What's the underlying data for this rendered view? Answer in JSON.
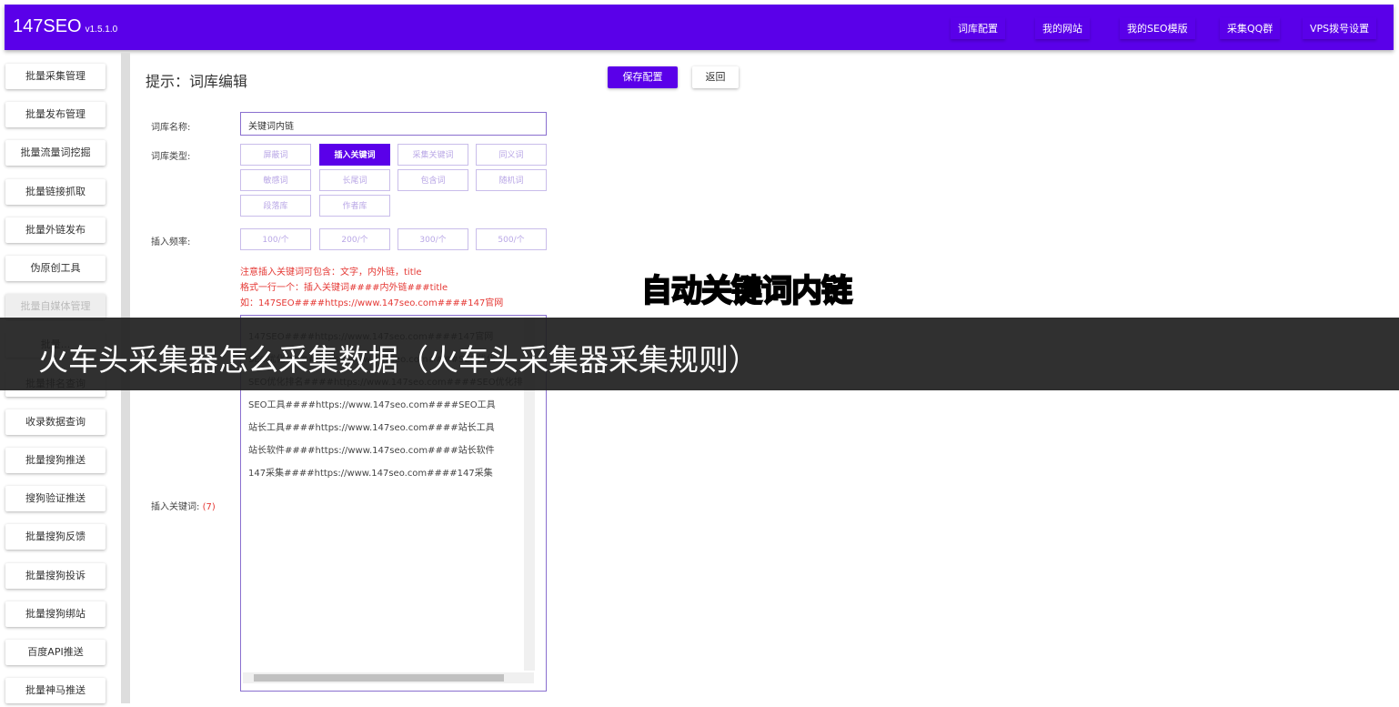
{
  "header": {
    "logo": "147SEO",
    "version": "v1.5.1.0",
    "nav": [
      "词库配置",
      "我的网站",
      "我的SEO模版",
      "采集QQ群",
      "VPS拨号设置"
    ]
  },
  "sidebar": {
    "items": [
      "批量采集管理",
      "批量发布管理",
      "批量流量词挖掘",
      "批量链接抓取",
      "批量外链发布",
      "伪原创工具",
      "批量自媒体管理",
      "批量...",
      "批量排名查询",
      "收录数据查询",
      "批量搜狗推送",
      "搜狗验证推送",
      "批量搜狗反馈",
      "批量搜狗投诉",
      "批量搜狗绑站",
      "百度API推送",
      "批量神马推送"
    ]
  },
  "main": {
    "title": "提示：词库编辑",
    "save": "保存配置",
    "back": "返回",
    "name_label": "词库名称:",
    "name_value": "关键词内链",
    "type_label": "词库类型:",
    "types": [
      "屏蔽词",
      "插入关键词",
      "采集关键词",
      "同义词",
      "敏感词",
      "长尾词",
      "包含词",
      "随机词",
      "段落库",
      "作者库"
    ],
    "selected_type": "插入关键词",
    "freq_label": "插入频率:",
    "freqs": [
      "100/个",
      "200/个",
      "300/个",
      "500/个"
    ],
    "notes": [
      "注意插入关键词可包含：文字，内外链，title",
      "格式一行一个：插入关键词####内外链###title",
      "如：147SEO####https://www.147seo.com####147官网"
    ],
    "kw_label": "插入关键词:",
    "kw_count": "(7)",
    "keywords": [
      "147SEO####https://www.147seo.com####147官网",
      "SEO优化####https://www.147seo.com####SEO优化",
      "SEO优化排名####https://www.147seo.com####SEO优化排",
      "SEO工具####https://www.147seo.com####SEO工具",
      "站长工具####https://www.147seo.com####站长工具",
      "站长软件####https://www.147seo.com####站长软件",
      "147采集####https://www.147seo.com####147采集"
    ]
  },
  "caption": "自动关键词内链",
  "overlay_title": "火车头采集器怎么采集数据（火车头采集器采集规则）",
  "colors": {
    "accent": "#5a00e9",
    "note": "#e53935",
    "caption": "#ffe600"
  }
}
